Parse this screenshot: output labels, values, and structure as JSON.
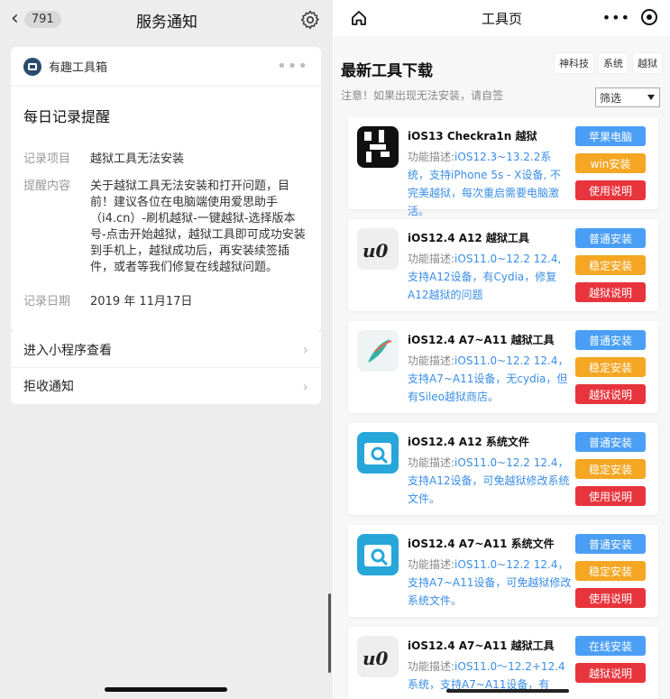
{
  "left": {
    "nav": {
      "back_count": "791",
      "title": "服务通知"
    },
    "card": {
      "app_name": "有趣工具箱",
      "title": "每日记录提醒",
      "rows": [
        {
          "k": "记录项目",
          "v": "越狱工具无法安装"
        },
        {
          "k": "提醒内容",
          "v": "关于越狱工具无法安装和打开问题，目前！建议各位在电脑端使用爱思助手（i4.cn）-刷机越狱-一键越狱-选择版本号-点击开始越狱，越狱工具即可成功安装到手机上，越狱成功后，再安装续签插件，或者等我们修复在线越狱问题。"
        },
        {
          "k": "记录日期",
          "v": "2019 年 11月17日"
        }
      ]
    },
    "links": [
      "进入小程序查看",
      "拒收通知"
    ]
  },
  "right": {
    "nav": {
      "title": "工具页"
    },
    "heading": "最新工具下载",
    "tags": [
      "神科技",
      "系统",
      "越狱"
    ],
    "notice": "注意！如果出现无法安装，请自签",
    "select": "筛选",
    "desc_label": "功能描述:",
    "tools": [
      {
        "name": "iOS13 Checkra1n 越狱",
        "desc": "iOS12.3~13.2.2系统，支持iPhone 5s - X设备, 不完美越狱，每次重启需要电脑激活。",
        "buttons": [
          "苹果电脑",
          "win安装",
          "使用说明"
        ],
        "thumb": "checkra1n-logo"
      },
      {
        "name": "iOS12.4 A12 越狱工具",
        "desc": "iOS11.0~12.2 12.4,支持A12设备，有Cydia，修复A12越狱的问题",
        "buttons": [
          "普通安装",
          "稳定安装",
          "越狱说明"
        ],
        "thumb": "unc0ver-logo"
      },
      {
        "name": "iOS12.4 A7~A11 越狱工具",
        "desc": "iOS11.0~12.2 12.4，支持A7~A11设备，无cydia，但有Sileo越狱商店。",
        "buttons": [
          "普通安装",
          "稳定安装",
          "越狱说明"
        ],
        "thumb": "feather-logo"
      },
      {
        "name": "iOS12.4 A12 系统文件",
        "desc": "iOS11.0~12.2 12.4，支持A12设备，可免越狱修改系统文件。",
        "buttons": [
          "普通安装",
          "稳定安装",
          "使用说明"
        ],
        "thumb": "filza-logo"
      },
      {
        "name": "iOS12.4 A7~A11 系统文件",
        "desc": "iOS11.0~12.2 12.4，支持A7~A11设备，可免越狱修改系统文件。",
        "buttons": [
          "普通安装",
          "稳定安装",
          "使用说明"
        ],
        "thumb": "filza-logo"
      },
      {
        "name": "iOS12.4 A7~A11 越狱工具",
        "desc": "iOS11.0～12.2+12.4系统，支持A7~A11设备，有",
        "buttons": [
          "在线安装",
          "越狱说明"
        ],
        "thumb": "unc0ver-logo"
      }
    ]
  },
  "colors": {
    "link_blue": "#3a8ee6",
    "btn_blue": "#4a9ff5",
    "btn_orange": "#f5a623",
    "btn_red": "#e8343c"
  }
}
